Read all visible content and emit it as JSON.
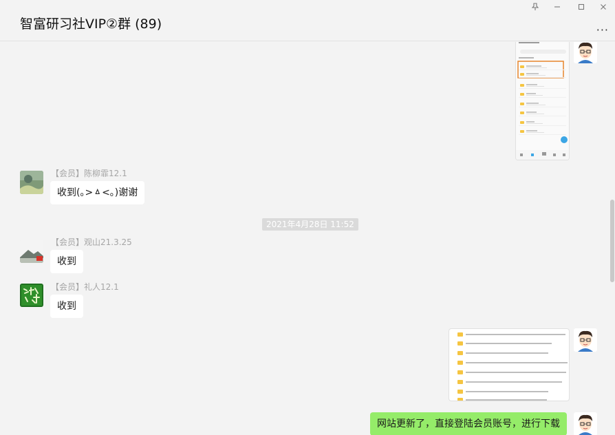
{
  "window": {
    "title": "智富研习社VIP②群 (89)",
    "controls": [
      "pin-icon",
      "minimize-icon",
      "maximize-icon",
      "close-icon"
    ],
    "more_label": "···"
  },
  "messages": [
    {
      "sender": "【会员】陈柳霏12.1",
      "text": "收到(｡>ㅿ<｡)谢谢"
    },
    {
      "timestamp": "2021年4月28日 11:52"
    },
    {
      "sender": "【会员】观山21.3.25",
      "text": "收到"
    },
    {
      "sender": "【会员】礼人12.1",
      "text": "收到"
    },
    {
      "self": true,
      "text": "网站更新了，直接登陆会员账号，进行下载"
    }
  ],
  "colors": {
    "background": "#f3f3f3",
    "bubble_other": "#ffffff",
    "bubble_self": "#95ec69",
    "timestamp_bg": "#dadada",
    "highlight": "#e8842a"
  }
}
